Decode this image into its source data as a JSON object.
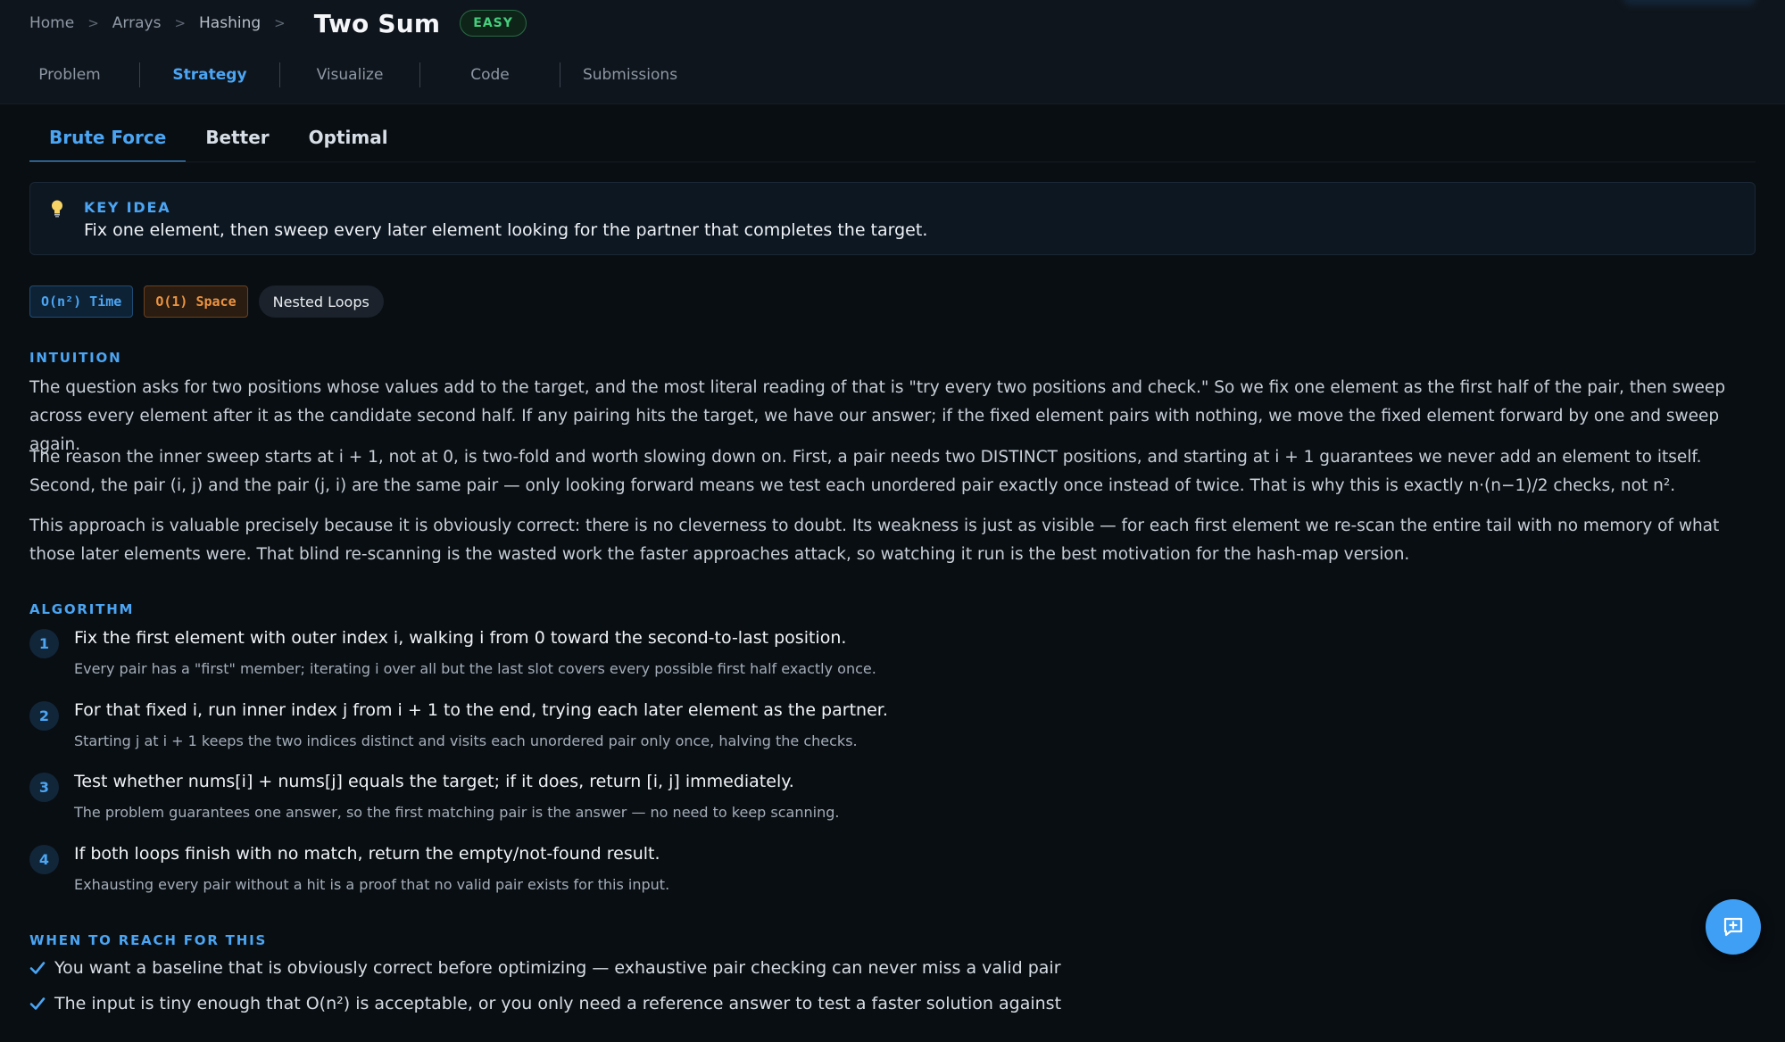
{
  "breadcrumb": {
    "items": [
      "Home",
      "Arrays",
      "Hashing"
    ],
    "separator": ">"
  },
  "problem": {
    "title": "Two Sum",
    "difficulty": "EASY"
  },
  "main_tabs": [
    {
      "label": "Problem",
      "active": false
    },
    {
      "label": "Strategy",
      "active": true
    },
    {
      "label": "Visualize",
      "active": false
    },
    {
      "label": "Code",
      "active": false
    },
    {
      "label": "Submissions",
      "active": false
    }
  ],
  "approach_tabs": [
    {
      "label": "Brute Force",
      "active": true
    },
    {
      "label": "Better",
      "active": false
    },
    {
      "label": "Optimal",
      "active": false
    }
  ],
  "key_idea": {
    "label": "KEY IDEA",
    "text": "Fix one element, then sweep every later element looking for the partner that completes the target."
  },
  "chips": {
    "time": "O(n²) Time",
    "space": "O(1) Space",
    "tag": "Nested Loops"
  },
  "intuition": {
    "heading": "INTUITION",
    "paragraphs": [
      "The question asks for two positions whose values add to the target, and the most literal reading of that is \"try every two positions and check.\" So we fix one element as the first half of the pair, then sweep across every element after it as the candidate second half. If any pairing hits the target, we have our answer; if the fixed element pairs with nothing, we move the fixed element forward by one and sweep again.",
      "The reason the inner sweep starts at i + 1, not at 0, is two-fold and worth slowing down on. First, a pair needs two DISTINCT positions, and starting at i + 1 guarantees we never add an element to itself. Second, the pair (i, j) and the pair (j, i) are the same pair — only looking forward means we test each unordered pair exactly once instead of twice. That is why this is exactly n·(n−1)/2 checks, not n².",
      "This approach is valuable precisely because it is obviously correct: there is no cleverness to doubt. Its weakness is just as visible — for each first element we re-scan the entire tail with no memory of what those later elements were. That blind re-scanning is the wasted work the faster approaches attack, so watching it run is the best motivation for the hash-map version."
    ]
  },
  "algorithm": {
    "heading": "ALGORITHM",
    "steps": [
      {
        "num": "1",
        "title": "Fix the first element with outer index i, walking i from 0 toward the second-to-last position.",
        "detail": "Every pair has a \"first\" member; iterating i over all but the last slot covers every possible first half exactly once."
      },
      {
        "num": "2",
        "title": "For that fixed i, run inner index j from i + 1 to the end, trying each later element as the partner.",
        "detail": "Starting j at i + 1 keeps the two indices distinct and visits each unordered pair only once, halving the checks."
      },
      {
        "num": "3",
        "title": "Test whether nums[i] + nums[j] equals the target; if it does, return [i, j] immediately.",
        "detail": "The problem guarantees one answer, so the first matching pair is the answer — no need to keep scanning."
      },
      {
        "num": "4",
        "title": "If both loops finish with no match, return the empty/not-found result.",
        "detail": "Exhausting every pair without a hit is a proof that no valid pair exists for this input."
      }
    ]
  },
  "when_to_use": {
    "heading": "WHEN TO REACH FOR THIS",
    "items": [
      "You want a baseline that is obviously correct before optimizing — exhaustive pair checking can never miss a valid pair",
      "The input is tiny enough that O(n²) is acceptable, or you only need a reference answer to test a faster solution against"
    ]
  },
  "icons": {
    "key_idea": "lightbulb-icon",
    "check": "check-icon",
    "fab": "chat-add-icon",
    "separator": "chevron-right-icon"
  },
  "colors": {
    "accent": "#4ba5f3",
    "easy": "#45cf7c",
    "space_chip": "#ec9442",
    "background": "#090e13"
  }
}
